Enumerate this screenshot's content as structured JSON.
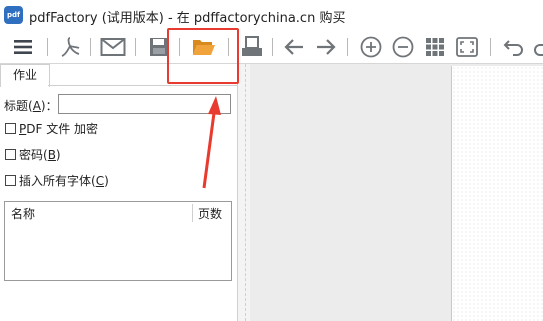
{
  "window": {
    "title": "pdfFactory (试用版本) - 在 pdffactorychina.cn 购买",
    "app_icon_text": "pdf"
  },
  "toolbar": {
    "buttons": [
      {
        "name": "menu-icon"
      },
      {
        "name": "acrobat-icon"
      },
      {
        "name": "email-icon"
      },
      {
        "name": "save-icon"
      },
      {
        "name": "open-folder-icon",
        "highlighted": true
      },
      {
        "name": "print-icon"
      },
      {
        "name": "back-arrow-icon"
      },
      {
        "name": "forward-arrow-icon"
      },
      {
        "name": "zoom-in-icon"
      },
      {
        "name": "zoom-out-icon"
      },
      {
        "name": "grid-view-icon"
      },
      {
        "name": "fit-screen-icon"
      },
      {
        "name": "undo-icon"
      },
      {
        "name": "redo-icon"
      }
    ]
  },
  "colors": {
    "highlight": "#e83a2e",
    "folder": "#e8a23a",
    "icon": "#6f7479"
  },
  "job_panel": {
    "tab_label": "作业",
    "title_label_prefix": "标题(",
    "title_label_key": "A",
    "title_label_suffix": ")：",
    "title_value": "",
    "pdf_encrypt_key": "P",
    "pdf_encrypt_rest": "DF 文件 加密",
    "password_prefix": "密码(",
    "password_key": "B",
    "password_suffix": ")",
    "embed_fonts_prefix": "插入所有字体(",
    "embed_fonts_key": "C",
    "embed_fonts_suffix": ")",
    "list_columns": [
      "名称",
      "页数"
    ]
  }
}
